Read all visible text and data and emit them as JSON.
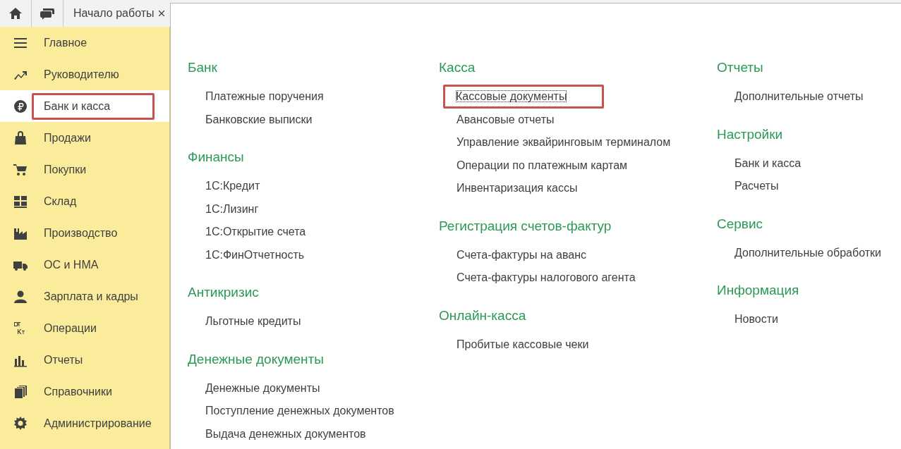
{
  "top_bar": {
    "tab": {
      "label": "Начало работы"
    }
  },
  "sidebar": {
    "items": [
      {
        "label": "Главное",
        "selected": false,
        "highlighted": false
      },
      {
        "label": "Руководителю",
        "selected": false,
        "highlighted": false
      },
      {
        "label": "Банк и касса",
        "selected": true,
        "highlighted": true
      },
      {
        "label": "Продажи",
        "selected": false,
        "highlighted": false
      },
      {
        "label": "Покупки",
        "selected": false,
        "highlighted": false
      },
      {
        "label": "Склад",
        "selected": false,
        "highlighted": false
      },
      {
        "label": "Производство",
        "selected": false,
        "highlighted": false
      },
      {
        "label": "ОС и НМА",
        "selected": false,
        "highlighted": false
      },
      {
        "label": "Зарплата и кадры",
        "selected": false,
        "highlighted": false
      },
      {
        "label": "Операции",
        "selected": false,
        "highlighted": false
      },
      {
        "label": "Отчеты",
        "selected": false,
        "highlighted": false
      },
      {
        "label": "Справочники",
        "selected": false,
        "highlighted": false
      },
      {
        "label": "Администрирование",
        "selected": false,
        "highlighted": false
      }
    ]
  },
  "panel": {
    "columns": [
      [
        {
          "title": "Банк",
          "links": [
            {
              "label": "Платежные поручения",
              "highlighted": false
            },
            {
              "label": "Банковские выписки",
              "highlighted": false
            }
          ]
        },
        {
          "title": "Финансы",
          "links": [
            {
              "label": "1С:Кредит",
              "highlighted": false
            },
            {
              "label": "1С:Лизинг",
              "highlighted": false
            },
            {
              "label": "1С:Открытие счета",
              "highlighted": false
            },
            {
              "label": "1С:ФинОтчетность",
              "highlighted": false
            }
          ]
        },
        {
          "title": "Антикризис",
          "links": [
            {
              "label": "Льготные кредиты",
              "highlighted": false
            }
          ]
        },
        {
          "title": "Денежные документы",
          "links": [
            {
              "label": "Денежные документы",
              "highlighted": false
            },
            {
              "label": "Поступление денежных документов",
              "highlighted": false
            },
            {
              "label": "Выдача денежных документов",
              "highlighted": false
            }
          ]
        }
      ],
      [
        {
          "title": "Касса",
          "links": [
            {
              "label": "Кассовые документы",
              "highlighted": true
            },
            {
              "label": "Авансовые отчеты",
              "highlighted": false
            },
            {
              "label": "Управление эквайринговым терминалом",
              "highlighted": false
            },
            {
              "label": "Операции по платежным картам",
              "highlighted": false
            },
            {
              "label": "Инвентаризация кассы",
              "highlighted": false
            }
          ]
        },
        {
          "title": "Регистрация счетов-фактур",
          "links": [
            {
              "label": "Счета-фактуры на аванс",
              "highlighted": false
            },
            {
              "label": "Счета-фактуры налогового агента",
              "highlighted": false
            }
          ]
        },
        {
          "title": "Онлайн-касса",
          "links": [
            {
              "label": "Пробитые кассовые чеки",
              "highlighted": false
            }
          ]
        }
      ],
      [
        {
          "title": "Отчеты",
          "links": [
            {
              "label": "Дополнительные отчеты",
              "highlighted": false
            }
          ]
        },
        {
          "title": "Настройки",
          "links": [
            {
              "label": "Банк и касса",
              "highlighted": false
            },
            {
              "label": "Расчеты",
              "highlighted": false
            }
          ]
        },
        {
          "title": "Сервис",
          "links": [
            {
              "label": "Дополнительные обработки",
              "highlighted": false
            }
          ]
        },
        {
          "title": "Информация",
          "links": [
            {
              "label": "Новости",
              "highlighted": false
            }
          ]
        }
      ]
    ]
  }
}
